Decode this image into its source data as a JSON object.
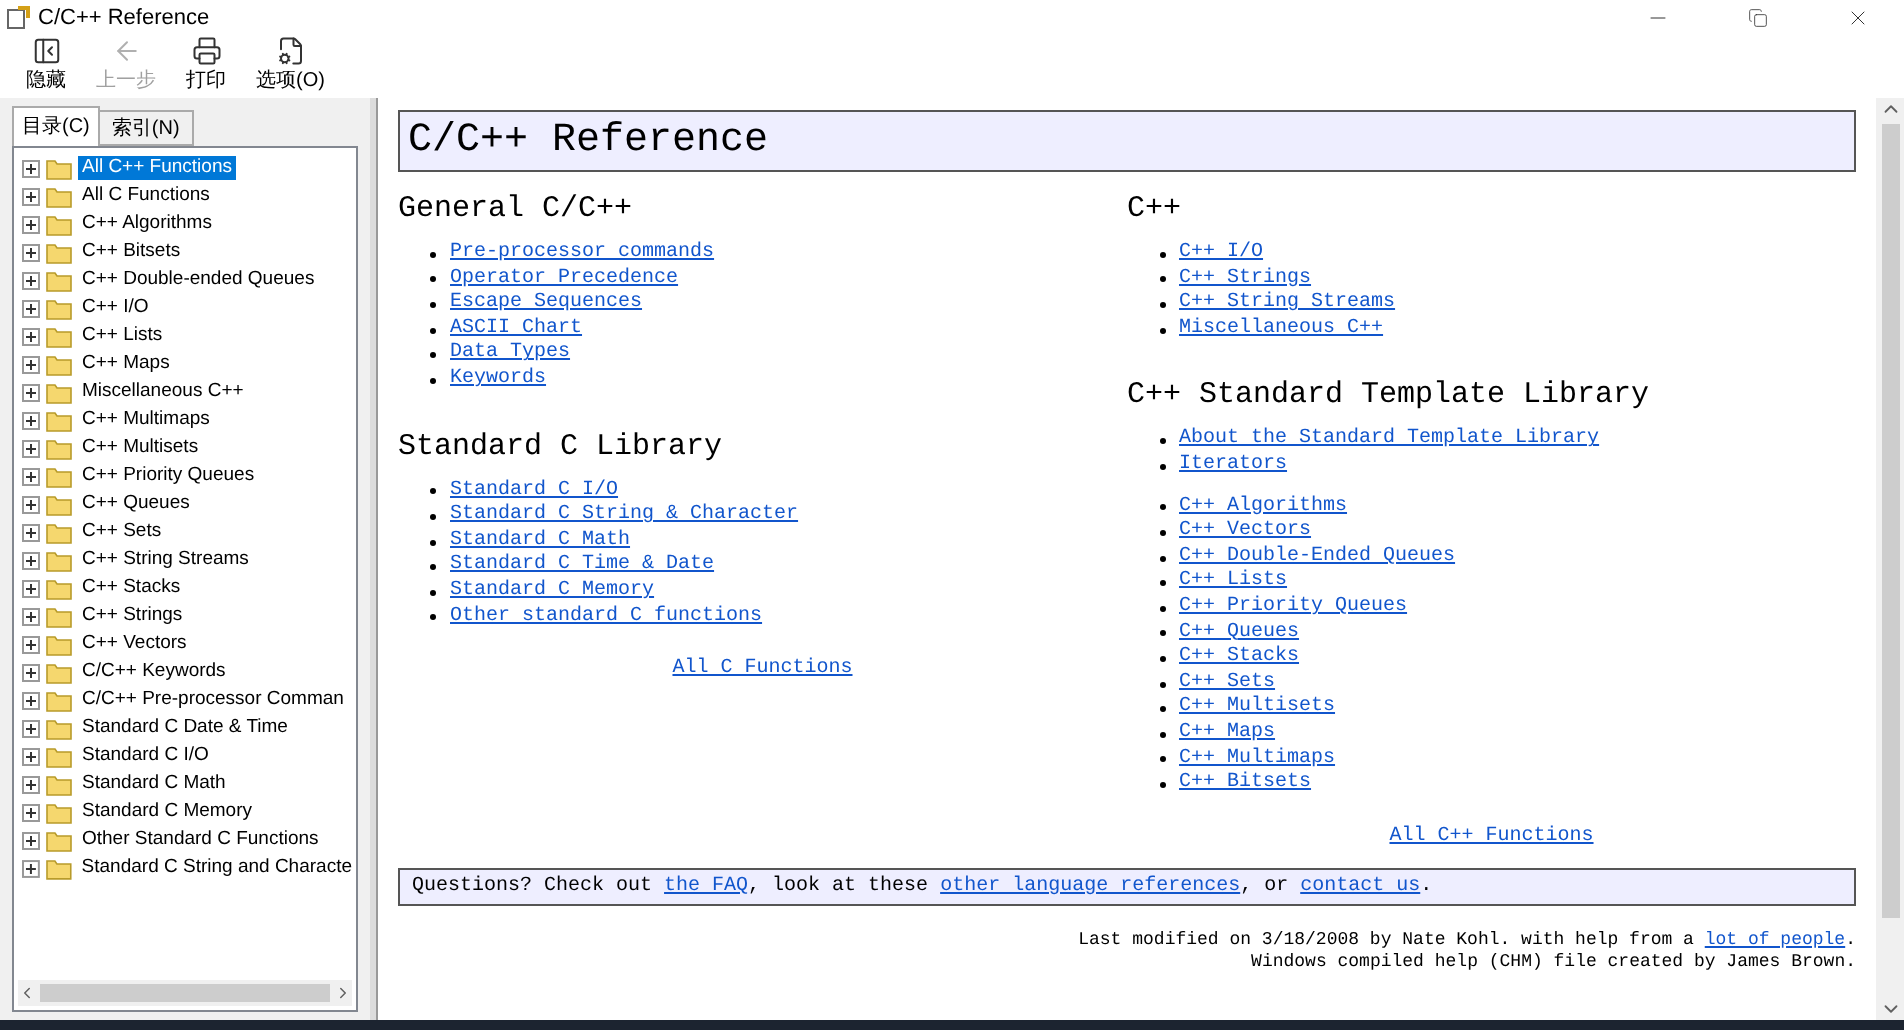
{
  "window": {
    "title": "C/C++ Reference"
  },
  "toolbar": [
    {
      "label": "隐藏",
      "disabled": false
    },
    {
      "label": "上一步",
      "disabled": true
    },
    {
      "label": "打印",
      "disabled": false
    },
    {
      "label": "选项(O)",
      "disabled": false
    }
  ],
  "nav_tabs": [
    {
      "label": "目录(C)",
      "selected": true
    },
    {
      "label": "索引(N)",
      "selected": false
    }
  ],
  "tree": [
    {
      "label": "All C++ Functions",
      "selected": true,
      "expanded": false
    },
    {
      "label": "All C Functions",
      "selected": false,
      "expanded": false
    },
    {
      "label": "C++ Algorithms",
      "selected": false,
      "expanded": false
    },
    {
      "label": "C++ Bitsets",
      "selected": false,
      "expanded": false
    },
    {
      "label": "C++ Double-ended Queues",
      "selected": false,
      "expanded": false
    },
    {
      "label": "C++ I/O",
      "selected": false,
      "expanded": false
    },
    {
      "label": "C++ Lists",
      "selected": false,
      "expanded": false
    },
    {
      "label": "C++ Maps",
      "selected": false,
      "expanded": false
    },
    {
      "label": "Miscellaneous C++",
      "selected": false,
      "expanded": false
    },
    {
      "label": "C++ Multimaps",
      "selected": false,
      "expanded": false
    },
    {
      "label": "C++ Multisets",
      "selected": false,
      "expanded": false
    },
    {
      "label": "C++ Priority Queues",
      "selected": false,
      "expanded": false
    },
    {
      "label": "C++ Queues",
      "selected": false,
      "expanded": false
    },
    {
      "label": "C++ Sets",
      "selected": false,
      "expanded": false
    },
    {
      "label": "C++ String Streams",
      "selected": false,
      "expanded": false
    },
    {
      "label": "C++ Stacks",
      "selected": false,
      "expanded": false
    },
    {
      "label": "C++ Strings",
      "selected": false,
      "expanded": false
    },
    {
      "label": "C++ Vectors",
      "selected": false,
      "expanded": false
    },
    {
      "label": "C/C++ Keywords",
      "selected": false,
      "expanded": false
    },
    {
      "label": "C/C++ Pre-processor Comman",
      "selected": false,
      "expanded": false
    },
    {
      "label": "Standard C Date & Time",
      "selected": false,
      "expanded": false
    },
    {
      "label": "Standard C I/O",
      "selected": false,
      "expanded": false
    },
    {
      "label": "Standard C Math",
      "selected": false,
      "expanded": false
    },
    {
      "label": "Standard C Memory",
      "selected": false,
      "expanded": false
    },
    {
      "label": "Other Standard C Functions",
      "selected": false,
      "expanded": false
    },
    {
      "label": "Standard C String and Characte",
      "selected": false,
      "expanded": false
    }
  ],
  "page": {
    "title": "C/C++ Reference",
    "columns": [
      {
        "sections": [
          {
            "heading": "General C/C++",
            "groups": [
              [
                "Pre-processor commands",
                "Operator Precedence",
                "Escape Sequences",
                "ASCII Chart",
                "Data Types",
                "Keywords"
              ]
            ]
          },
          {
            "heading": "Standard C Library",
            "groups": [
              [
                "Standard C I/O",
                "Standard C String & Character",
                "Standard C Math",
                "Standard C Time & Date",
                "Standard C Memory",
                "Other standard C functions"
              ]
            ]
          }
        ],
        "all_link": "All C Functions"
      },
      {
        "sections": [
          {
            "heading": "C++",
            "groups": [
              [
                "C++ I/O",
                "C++ Strings",
                "C++ String Streams",
                "Miscellaneous C++"
              ]
            ]
          },
          {
            "heading": "C++ Standard Template Library",
            "groups": [
              [
                "About the Standard Template Library",
                "Iterators"
              ],
              [
                "C++ Algorithms",
                "C++ Vectors",
                "C++ Double-Ended Queues",
                "C++ Lists",
                "C++ Priority Queues",
                "C++ Queues",
                "C++ Stacks",
                "C++ Sets",
                "C++ Multisets",
                "C++ Maps",
                "C++ Multimaps",
                "C++ Bitsets"
              ]
            ]
          }
        ],
        "all_link": "All C++ Functions"
      }
    ],
    "notice": [
      {
        "kind": "text",
        "text": "Questions? Check out "
      },
      {
        "kind": "link",
        "text": "the FAQ"
      },
      {
        "kind": "text",
        "text": ", look at these "
      },
      {
        "kind": "link",
        "text": "other language references"
      },
      {
        "kind": "text",
        "text": ", or "
      },
      {
        "kind": "link",
        "text": "contact us"
      },
      {
        "kind": "text",
        "text": "."
      }
    ],
    "credits": [
      [
        {
          "kind": "text",
          "text": "Last modified on 3/18/2008 by Nate Kohl. with help from a "
        },
        {
          "kind": "link",
          "text": "lot of people"
        },
        {
          "kind": "text",
          "text": "."
        }
      ],
      [
        {
          "kind": "text",
          "text": "Windows compiled help (CHM) file created by James Brown."
        }
      ]
    ]
  }
}
